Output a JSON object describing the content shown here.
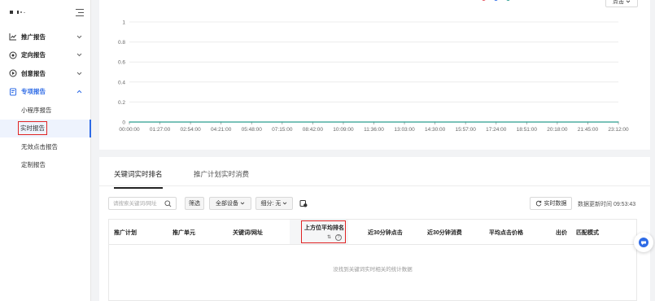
{
  "sidebar": {
    "items": [
      {
        "label": "推广报告",
        "icon": "trend-chart-icon",
        "expanded": false
      },
      {
        "label": "定向报告",
        "icon": "target-icon",
        "expanded": false
      },
      {
        "label": "创意报告",
        "icon": "play-circle-icon",
        "expanded": false
      },
      {
        "label": "专项报告",
        "icon": "report-doc-icon",
        "expanded": true
      }
    ],
    "sub_items": [
      {
        "label": "小程序报告"
      },
      {
        "label": "实时报告"
      },
      {
        "label": "无效点击报告"
      },
      {
        "label": "定制报告"
      }
    ],
    "selected_sub_item": "实时报告"
  },
  "chart_button": {
    "label": "点击"
  },
  "chart_data": {
    "type": "line",
    "x": [
      "00:00:00",
      "01:27:00",
      "02:54:00",
      "04:21:00",
      "05:48:00",
      "07:15:00",
      "08:42:00",
      "10:09:00",
      "11:36:00",
      "13:03:00",
      "14:30:00",
      "15:57:00",
      "17:24:00",
      "18:51:00",
      "20:18:00",
      "21:45:00",
      "23:12:00"
    ],
    "y_ticks": [
      "0",
      "0.2",
      "0.4",
      "0.6",
      "0.8",
      "1"
    ],
    "ylim": [
      0,
      1
    ],
    "series": [
      {
        "values": [
          0,
          0,
          0,
          0,
          0,
          0,
          0,
          0,
          0,
          0,
          0,
          0,
          0,
          0,
          0,
          0,
          0
        ],
        "color": "#2a9d8f"
      }
    ],
    "legend_colors": [
      "#e34d59",
      "#2e6be6",
      "#2a9d8f"
    ],
    "grid": true
  },
  "tabs": [
    {
      "label": "关键词实时排名",
      "active": true
    },
    {
      "label": "推广计划实时消费",
      "active": false
    }
  ],
  "filters": {
    "search_placeholder": "请搜索关键词/网址",
    "filter_label": "筛选",
    "device_label": "全部设备",
    "breakdown_label": "细分: 无",
    "realtime_button": "实时数据",
    "updated_text": "数据更新时间 09:53:43"
  },
  "table": {
    "columns": [
      "推广计划",
      "推广单元",
      "关键词/网址",
      "上方位平均排名",
      "近30分钟点击",
      "近30分钟消费",
      "平均点击价格",
      "出价",
      "匹配模式"
    ],
    "highlighted_column": "上方位平均排名",
    "empty_text": "没找到关键词实时相关的统计数据"
  },
  "colors": {
    "accent": "#2e6be6",
    "highlight_border": "#e02424",
    "line": "#2a9d8f"
  }
}
